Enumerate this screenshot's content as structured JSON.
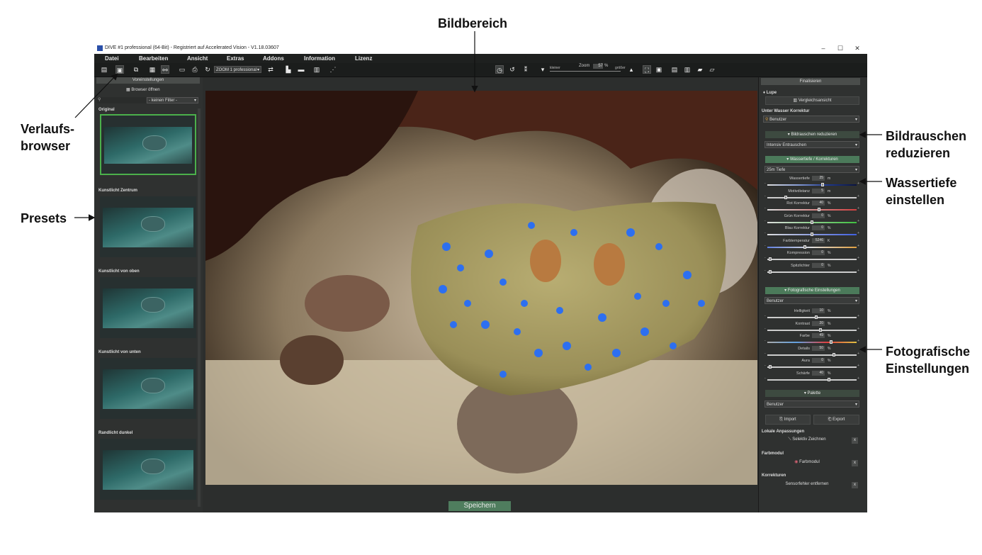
{
  "annotations": {
    "bildbereich": "Bildbereich",
    "verlaufsbrowser": "Verlaufs-\nbrowser",
    "presets": "Presets",
    "bildrauschen": "Bildrauschen\nreduzieren",
    "wassertiefe": "Wassertiefe\neinstellen",
    "fotografische": "Fotografische\nEinstellungen"
  },
  "window": {
    "title": "DIVE #1 professional (64-Bit) - Registriert auf Accelerated Vision - V1.18.03607",
    "minimize": "–",
    "maximize": "☐",
    "close": "✕"
  },
  "menu": [
    "Datei",
    "Bearbeiten",
    "Ansicht",
    "Extras",
    "Addons",
    "Information",
    "Lizenz"
  ],
  "toolbar": {
    "profile_select": "ZOOM 1 professional",
    "zoom_label": "Zoom",
    "zoom_value": "57",
    "zoom_unit": "%",
    "smaller_label": "kleiner",
    "larger_label": "größer",
    "icons": [
      "new-file-icon",
      "open-icon",
      "copy-icon",
      "batch-icon",
      "link-icon",
      "save-icon",
      "print-icon",
      "redo-icon",
      "export-icon",
      "export2-icon",
      "list-icon",
      "histogram-icon",
      "clock-icon",
      "rotate-icon",
      "flip-icon",
      "crop-icon",
      "compare-icon",
      "split-icon",
      "split2-icon",
      "comment-icon",
      "comment2-icon"
    ]
  },
  "left": {
    "header": "Voreinstellungen",
    "browser_button": "Browser öffnen",
    "filter_select": "- keinen Filter -",
    "presets": [
      "Original",
      "Kunstlicht Zentrum",
      "Kunstlicht von oben",
      "Kunstlicht von unten",
      "Randlicht dunkel"
    ]
  },
  "center": {
    "save_button": "Speichern"
  },
  "right": {
    "finalize_button": "Finalisieren",
    "lupe_label": "Lupe",
    "compare_button": "Vergleichsansicht",
    "underwater_section": "Unter Wasser Korrektur",
    "underwater_select": "Benutzer",
    "noise_button": "Bildrauschen reduzieren",
    "noise_select": "Intensiv Entrauschen",
    "depth_button": "Wassertiefe / Korrekturen",
    "depth_select": "25m Tiefe",
    "depth_sliders": [
      {
        "label": "Wassertiefe",
        "value": "25",
        "unit": "m",
        "pos": 0.62
      },
      {
        "label": "Motivdistanz",
        "value": "5",
        "unit": "m",
        "pos": 0.2
      },
      {
        "label": "Rot Korrektur",
        "value": "40",
        "unit": "%",
        "pos": 0.58
      },
      {
        "label": "Grün Korrektur",
        "value": "0",
        "unit": "%",
        "pos": 0.5
      },
      {
        "label": "Blau Korrektur",
        "value": "0",
        "unit": "%",
        "pos": 0.5
      },
      {
        "label": "Farbtemperatur",
        "value": "5246",
        "unit": "K",
        "pos": 0.42
      },
      {
        "label": "Kompression",
        "value": "0",
        "unit": "%",
        "pos": 0.02
      },
      {
        "label": "Spitzlichter",
        "value": "0",
        "unit": "%",
        "pos": 0.02
      }
    ],
    "photo_button": "Fotografische Einstellungen",
    "photo_select": "Benutzer",
    "photo_sliders": [
      {
        "label": "Helligkeit",
        "value": "10",
        "unit": "%",
        "pos": 0.55
      },
      {
        "label": "Kontrast",
        "value": "20",
        "unit": "%",
        "pos": 0.6
      },
      {
        "label": "Farbe",
        "value": "49",
        "unit": "%",
        "pos": 0.72
      },
      {
        "label": "Details",
        "value": "50",
        "unit": "%",
        "pos": 0.75
      },
      {
        "label": "Aura",
        "value": "0",
        "unit": "%",
        "pos": 0.02
      },
      {
        "label": "Schärfe",
        "value": "40",
        "unit": "%",
        "pos": 0.7
      }
    ],
    "palette_button": "Palette",
    "palette_select": "Benutzer",
    "import_button": "Import",
    "export_button": "Export",
    "local_section": "Lokale Anpassungen",
    "selective_button": "Selektiv Zeichnen",
    "color_section": "Farbmodul",
    "color_button": "Farbmodul",
    "corrections_section": "Korrekturen",
    "sensor_button": "Sensorfehler entfernen",
    "x_label": "x"
  },
  "colors": {
    "app_bg": "#2a2c2b",
    "green_button": "#4b7a5a",
    "selected_frame": "#4bb04b",
    "ray_spots": "#2d6ff0"
  }
}
